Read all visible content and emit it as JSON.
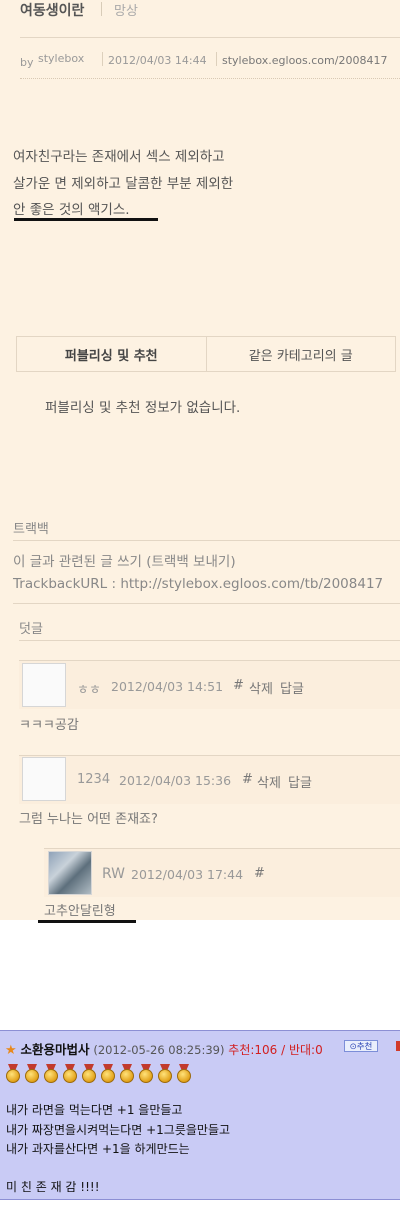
{
  "post": {
    "title": "여동생이란",
    "category": "망상",
    "by_label": "by",
    "author": "stylebox",
    "date": "2012/04/03 14:44",
    "url": "stylebox.egloos.com/2008417",
    "lines": [
      "여자친구라는 존재에서 섹스 제외하고",
      "살가운 면 제외하고 달콤한 부분 제외한",
      "안 좋은 것의 액기스."
    ]
  },
  "tabs": {
    "publishing": "퍼블리싱 및 추천",
    "same_category": "같은 카테고리의 글",
    "empty_message": "퍼블리싱 및 추천 정보가 없습니다."
  },
  "trackback": {
    "title": "트랙백",
    "write_link": "이 글과 관련된 글 쓰기 (트랙백 보내기)",
    "url_text": "TrackbackURL : http://stylebox.egloos.com/tb/2008417"
  },
  "comments": {
    "title": "덧글",
    "items": [
      {
        "name": "ㅎㅎ",
        "date": "2012/04/03 14:51",
        "hash": "#",
        "delete": "삭제",
        "reply": "답글",
        "text": "ㅋㅋㅋ공감"
      },
      {
        "name": "1234",
        "date": "2012/04/03 15:36",
        "hash": "#",
        "delete": "삭제",
        "reply": "답글",
        "text": "그럼 누나는 어떤 존재죠?"
      },
      {
        "name": "RW",
        "date": "2012/04/03 17:44",
        "hash": "#",
        "text": "고추안달린형"
      }
    ]
  },
  "board": {
    "username": "소환용마법사",
    "date": "(2012-05-26 08:25:39)",
    "votes": "추천:106 / 반대:0",
    "recommend_button": "⊙추천",
    "medal_count": 10,
    "lines": [
      "내가 라면을 먹는다면 +1 을만들고",
      "내가 짜장면을시켜먹는다면 +1그릇을만들고",
      "내가 과자를산다면 +1을 하게만드는",
      "미 친 존 재 감 !!!!"
    ],
    "colors": {
      "background": "#c9cbf5",
      "votes": "#d21f1f",
      "star": "#e8891b"
    }
  }
}
